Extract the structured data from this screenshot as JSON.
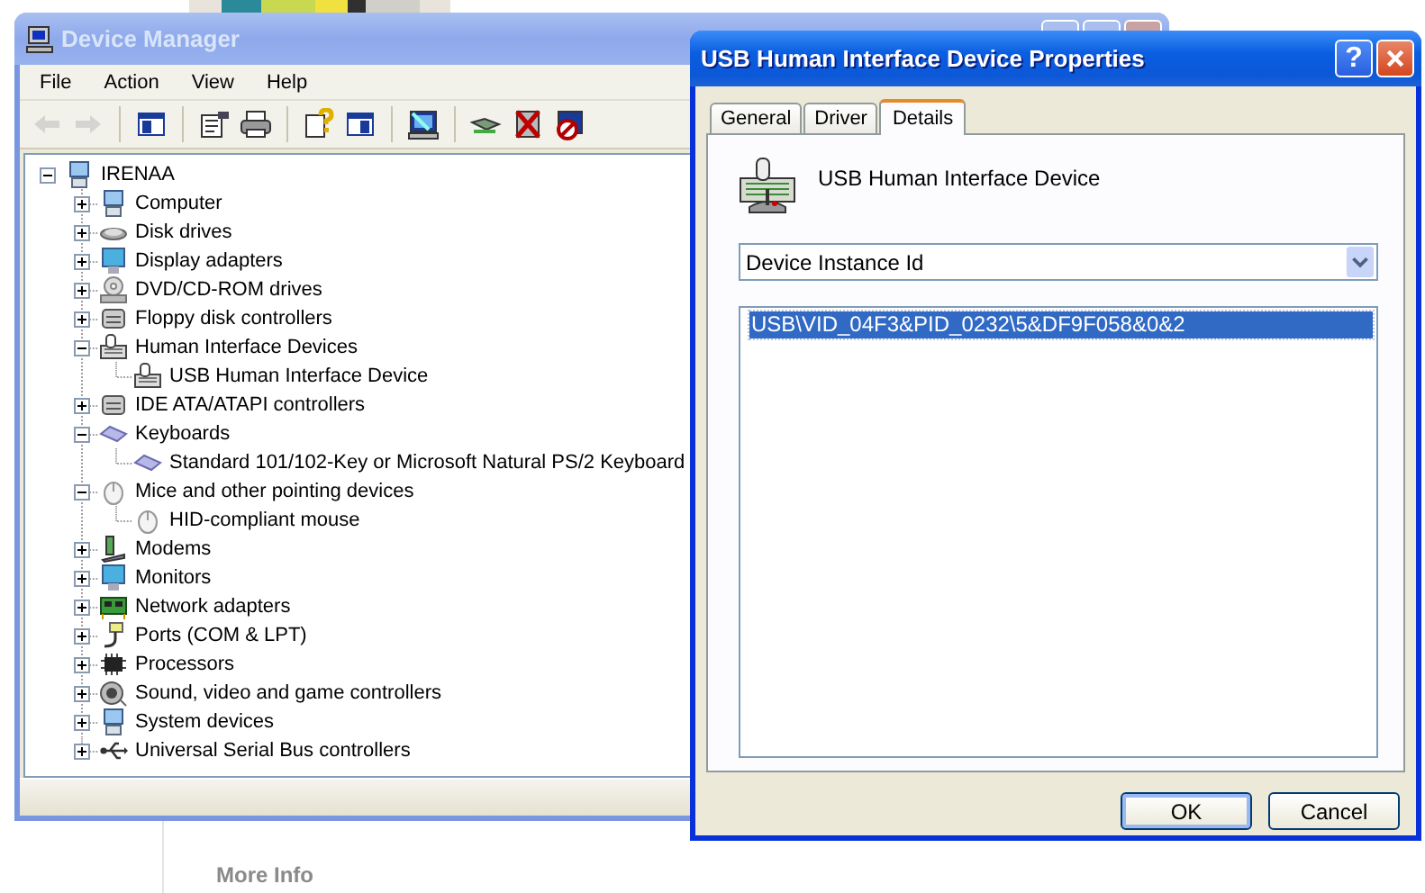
{
  "background_page": {
    "heading": "More Info"
  },
  "device_manager": {
    "title": "Device Manager",
    "active": false,
    "menu": [
      "File",
      "Action",
      "View",
      "Help"
    ],
    "toolbar": [
      {
        "kind": "back",
        "disabled": true
      },
      {
        "kind": "forward",
        "disabled": true
      },
      {
        "kind": "tree-pane",
        "disabled": false
      },
      {
        "kind": "properties",
        "disabled": false
      },
      {
        "kind": "print",
        "disabled": false
      },
      {
        "kind": "help",
        "disabled": false
      },
      {
        "kind": "action-pane",
        "disabled": false
      },
      {
        "kind": "scan",
        "disabled": false
      },
      {
        "kind": "update",
        "disabled": false
      },
      {
        "kind": "uninstall",
        "disabled": false
      },
      {
        "kind": "disable",
        "disabled": false
      }
    ],
    "tree": {
      "label": "IRENAA",
      "kind": "computer",
      "expanded": true,
      "children": [
        {
          "label": "Computer",
          "kind": "computer",
          "expanded": false
        },
        {
          "label": "Disk drives",
          "kind": "disk",
          "expanded": false
        },
        {
          "label": "Display adapters",
          "kind": "monitor",
          "expanded": false
        },
        {
          "label": "DVD/CD-ROM drives",
          "kind": "disc",
          "expanded": false
        },
        {
          "label": "Floppy disk controllers",
          "kind": "drive",
          "expanded": false
        },
        {
          "label": "Human Interface Devices",
          "kind": "hid",
          "expanded": true,
          "children": [
            {
              "label": "USB Human Interface Device",
              "kind": "hid"
            }
          ]
        },
        {
          "label": "IDE ATA/ATAPI controllers",
          "kind": "drive",
          "expanded": false
        },
        {
          "label": "Keyboards",
          "kind": "keyboard",
          "expanded": true,
          "children": [
            {
              "label": "Standard 101/102-Key or Microsoft Natural PS/2 Keyboard",
              "kind": "keyboard"
            }
          ]
        },
        {
          "label": "Mice and other pointing devices",
          "kind": "mouse",
          "expanded": true,
          "children": [
            {
              "label": "HID-compliant mouse",
              "kind": "mouse"
            }
          ]
        },
        {
          "label": "Modems",
          "kind": "modem",
          "expanded": false
        },
        {
          "label": "Monitors",
          "kind": "monitor",
          "expanded": false
        },
        {
          "label": "Network adapters",
          "kind": "network",
          "expanded": false
        },
        {
          "label": "Ports (COM & LPT)",
          "kind": "port",
          "expanded": false
        },
        {
          "label": "Processors",
          "kind": "chip",
          "expanded": false
        },
        {
          "label": "Sound, video and game controllers",
          "kind": "speaker",
          "expanded": false
        },
        {
          "label": "System devices",
          "kind": "computer",
          "expanded": false
        },
        {
          "label": "Universal Serial Bus controllers",
          "kind": "usb",
          "expanded": false
        }
      ]
    }
  },
  "properties_dialog": {
    "title": "USB Human Interface Device Properties",
    "active": true,
    "help_button": "?",
    "tabs": [
      {
        "label": "General",
        "selected": false
      },
      {
        "label": "Driver",
        "selected": false
      },
      {
        "label": "Details",
        "selected": true
      }
    ],
    "device_name": "USB Human Interface Device",
    "property_dropdown": {
      "value": "Device Instance Id"
    },
    "values": [
      {
        "text": "USB\\VID_04F3&PID_0232\\5&DF9F058&0&2",
        "selected": true
      }
    ],
    "buttons": [
      {
        "label": "OK",
        "default": true
      },
      {
        "label": "Cancel",
        "default": false
      }
    ]
  }
}
